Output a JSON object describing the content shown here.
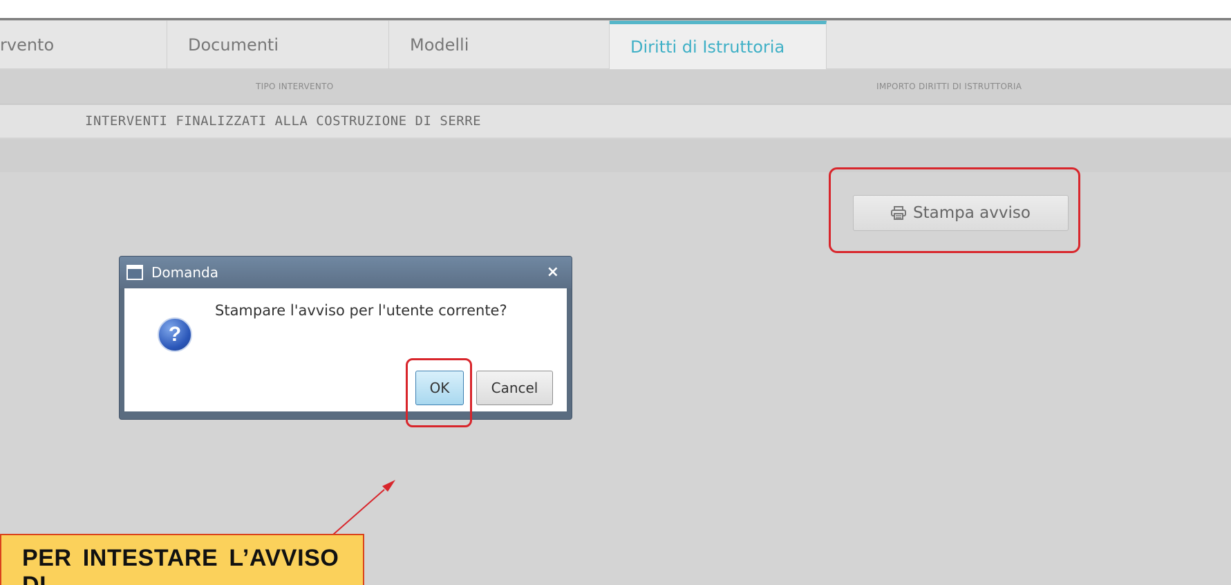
{
  "tabs": [
    {
      "label": "rvento",
      "active": false
    },
    {
      "label": "Documenti",
      "active": false
    },
    {
      "label": "Modelli",
      "active": false
    },
    {
      "label": "Diritti di Istruttoria",
      "active": true
    }
  ],
  "table": {
    "headers": [
      "TIPO INTERVENTO",
      "IMPORTO DIRITTI DI ISTRUTTORIA"
    ],
    "rows": [
      {
        "tipo_intervento": "INTERVENTI FINALIZZATI ALLA COSTRUZIONE DI SERRE",
        "importo": ""
      }
    ]
  },
  "stampa_button": {
    "label": "Stampa avviso",
    "icon": "printer-icon"
  },
  "dialog": {
    "title": "Domanda",
    "close_label": "×",
    "icon": "question-icon",
    "message": "Stampare l'avviso per l'utente corrente?",
    "ok_label": "OK",
    "cancel_label": "Cancel"
  },
  "callout": {
    "text": "PER INTESTARE L’AVVISO DI"
  },
  "colors": {
    "accent": "#3fb0c6",
    "highlight": "#d8252b",
    "callout_bg": "#fbd15b"
  }
}
